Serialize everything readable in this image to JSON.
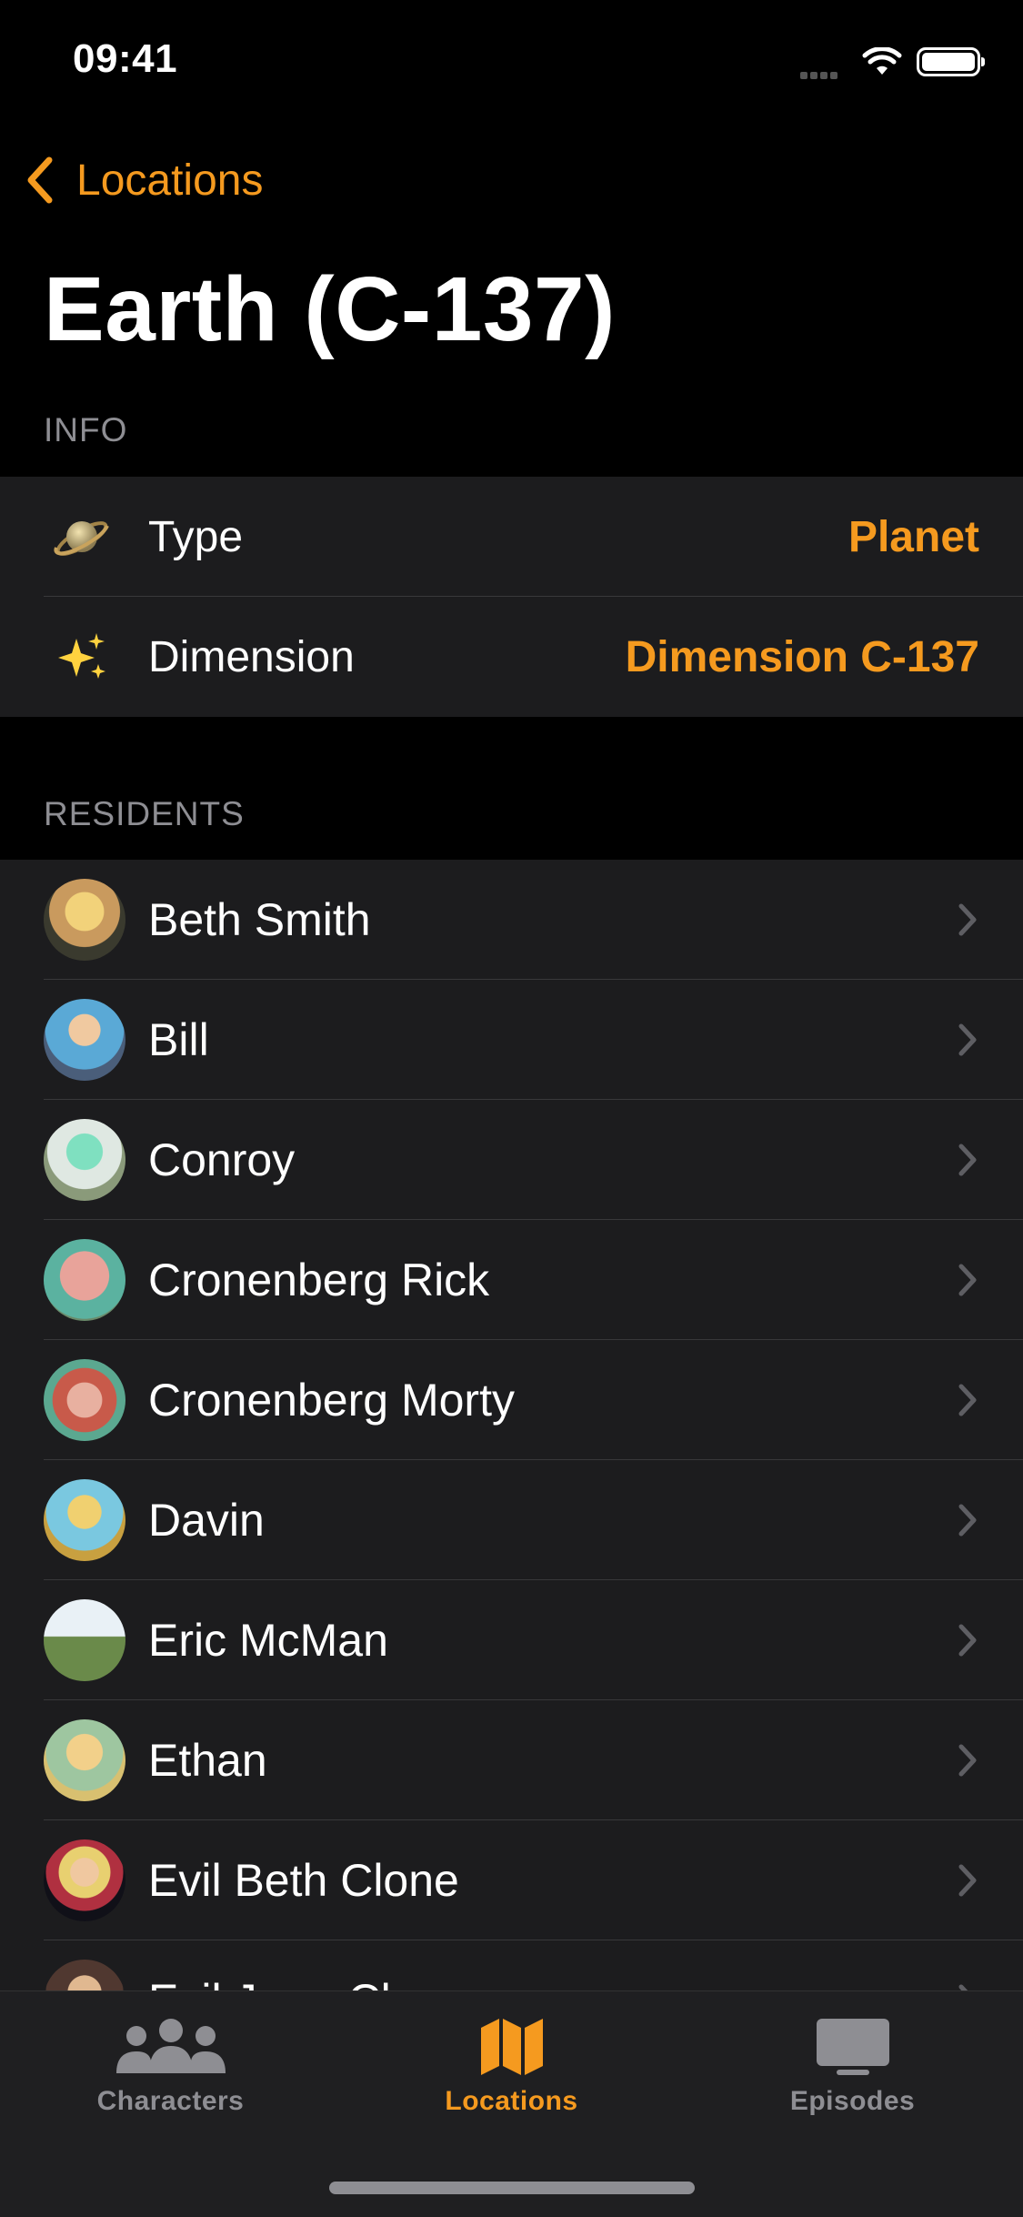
{
  "status_bar": {
    "time": "09:41"
  },
  "nav": {
    "back_label": "Locations"
  },
  "title": "Earth (C-137)",
  "info": {
    "header": "INFO",
    "rows": [
      {
        "icon": "ringed-planet-icon",
        "label": "Type",
        "value": "Planet"
      },
      {
        "icon": "sparkles-icon",
        "label": "Dimension",
        "value": "Dimension C-137"
      }
    ]
  },
  "residents": {
    "header": "RESIDENTS",
    "items": [
      {
        "name": "Beth Smith"
      },
      {
        "name": "Bill"
      },
      {
        "name": "Conroy"
      },
      {
        "name": "Cronenberg Rick"
      },
      {
        "name": "Cronenberg Morty"
      },
      {
        "name": "Davin"
      },
      {
        "name": "Eric McMan"
      },
      {
        "name": "Ethan"
      },
      {
        "name": "Evil Beth Clone"
      },
      {
        "name": "Evil Jerry Clone"
      }
    ]
  },
  "tabs": [
    {
      "label": "Characters",
      "icon": "people-icon",
      "active": false
    },
    {
      "label": "Locations",
      "icon": "map-icon",
      "active": true
    },
    {
      "label": "Episodes",
      "icon": "tv-icon",
      "active": false
    }
  ],
  "colors": {
    "accent": "#f59a1f",
    "background": "#000000",
    "cell": "#1c1c1e",
    "secondary": "#8e8e93"
  }
}
